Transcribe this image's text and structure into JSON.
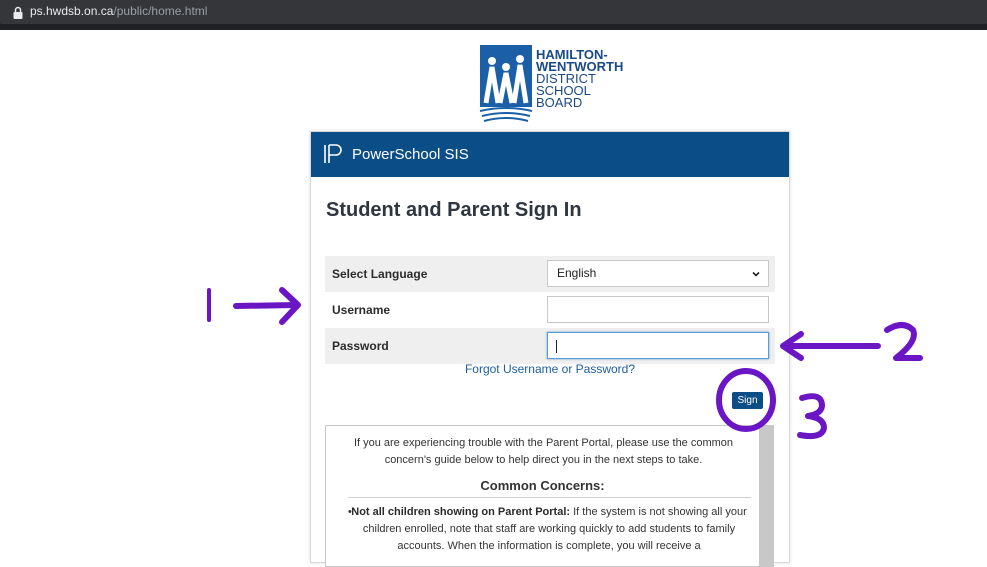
{
  "browser": {
    "url_domain": "ps.hwdsb.on.ca",
    "url_path": "/public/home.html"
  },
  "logo": {
    "line1": "HAMILTON-",
    "line2": "WENTWORTH",
    "line3": "DISTRICT",
    "line4": "SCHOOL",
    "line5": "BOARD"
  },
  "header": {
    "product": "PowerSchool SIS"
  },
  "page": {
    "title": "Student and Parent Sign In"
  },
  "form": {
    "language_label": "Select Language",
    "language_value": "English",
    "username_label": "Username",
    "username_value": "",
    "password_label": "Password",
    "password_value": "",
    "forgot_link": "Forgot Username or Password?",
    "signin_label": "Sign In"
  },
  "notice": {
    "intro": "If you are experiencing trouble with the Parent Portal, please use the common concern's guide below to help direct you in the next steps to take.",
    "heading": "Common Concerns:",
    "item1_title": "Not all children showing on Parent Portal:",
    "item1_text": "If the system is not showing all your children enrolled, note that staff are working quickly to add students to family accounts. When the information is complete, you will receive a"
  },
  "annotations": {
    "label1": "1",
    "label2": "2",
    "label3": "3",
    "color": "#6a16c4"
  },
  "colors": {
    "brand_blue": "#0b4d86",
    "link_blue": "#1c5fa0"
  }
}
